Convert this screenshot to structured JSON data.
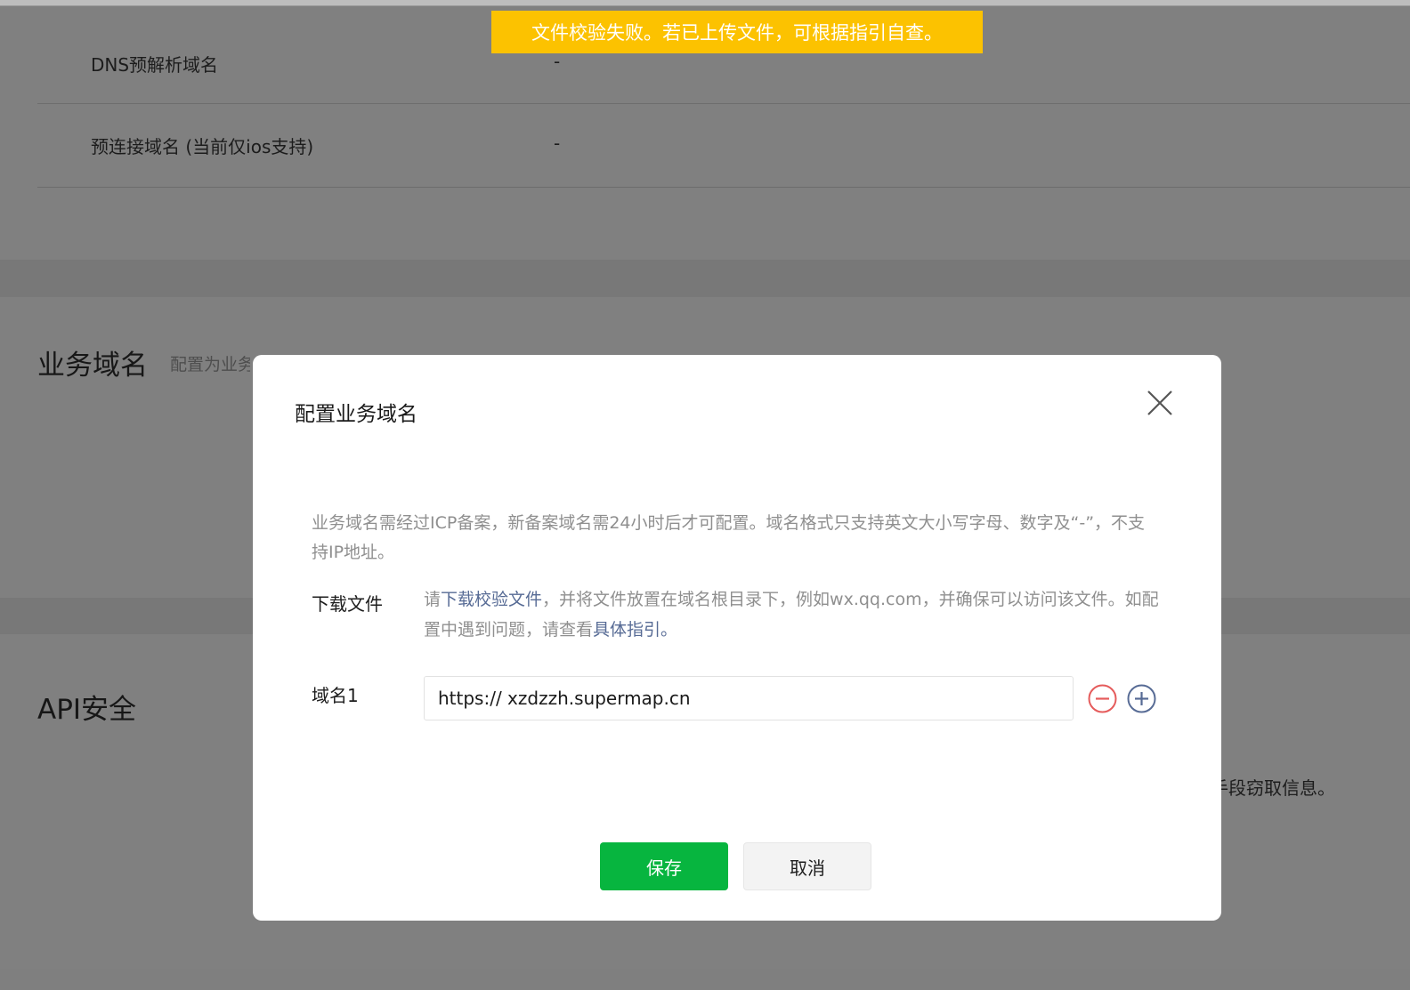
{
  "toast": {
    "message": "文件校验失败。若已上传文件，可根据指引自查。"
  },
  "background": {
    "rows": [
      {
        "label": "DNS预解析域名",
        "value": "-"
      },
      {
        "label": "预连接域名 (当前仅ios支持)",
        "value": "-"
      }
    ],
    "business_domain": {
      "title": "业务域名",
      "desc_visible": "配置为业务"
    },
    "api_security": {
      "title": "API安全",
      "trailing_text": "手段窃取信息。"
    }
  },
  "dialog": {
    "title": "配置业务域名",
    "close_icon": "close-icon",
    "description": "业务域名需经过ICP备案，新备案域名需24小时后才可配置。域名格式只支持英文大小写字母、数字及“-”，不支持IP地址。",
    "download": {
      "label": "下载文件",
      "text_before": "请",
      "link_text": "下载校验文件",
      "text_middle": "，并将文件放置在域名根目录下，例如wx.qq.com，并确保可以访问该文件。如配置中遇到问题，请查看",
      "guide_link": "具体指引。"
    },
    "domain_field": {
      "label": "域名1",
      "value": "https:// xzdzzh.supermap.cn",
      "remove_icon": "minus-circle-icon",
      "add_icon": "plus-circle-icon"
    },
    "buttons": {
      "save": "保存",
      "cancel": "取消"
    },
    "colors": {
      "primary": "#07b53f",
      "toast": "#fcc200",
      "link": "#576b95",
      "remove": "#e55b5b",
      "add": "#576b95"
    }
  }
}
